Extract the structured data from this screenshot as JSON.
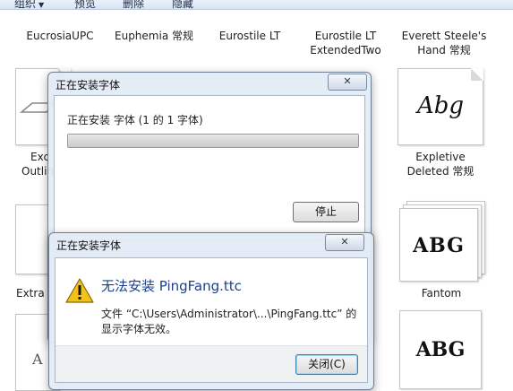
{
  "toolbar": {
    "items": [
      "组织",
      "预览",
      "删除",
      "隐藏"
    ]
  },
  "fonts_row1": [
    {
      "line1": "EucrosiaUPC",
      "line2": ""
    },
    {
      "line1": "Euphemia 常规",
      "line2": ""
    },
    {
      "line1": "Eurostile LT",
      "line2": ""
    },
    {
      "line1": "Eurostile LT",
      "line2": "ExtendedTwo"
    },
    {
      "line1": "Everett Steele's",
      "line2": "Hand 常规"
    }
  ],
  "fonts_row2": [
    {
      "line1": "Exc",
      "line2": "Outlin"
    },
    {
      "line1": "Expletive",
      "line2": "Deleted 常规"
    }
  ],
  "fonts_row3": [
    {
      "label": "Extra v"
    },
    {
      "label": "Fantom"
    }
  ],
  "tiles": {
    "hand_sample": "Abg",
    "sample_a": "ABG",
    "sample_b": "ABG"
  },
  "install_dialog": {
    "title": "正在安装字体",
    "close_glyph": "✕",
    "status": "正在安装 字体 (1 的 1 字体)",
    "stop_button": "停止"
  },
  "error_dialog": {
    "title": "正在安装字体",
    "close_glyph": "✕",
    "heading": "无法安装 PingFang.ttc",
    "message_line1": "文件 “C:\\Users\\Administrator\\...\\PingFang.ttc” 的",
    "message_line2": "显示字体无效。",
    "close_button": "关闭(C)"
  },
  "colors": {
    "heading_blue": "#1a3f8f",
    "warning_yellow": "#f2c21b"
  }
}
